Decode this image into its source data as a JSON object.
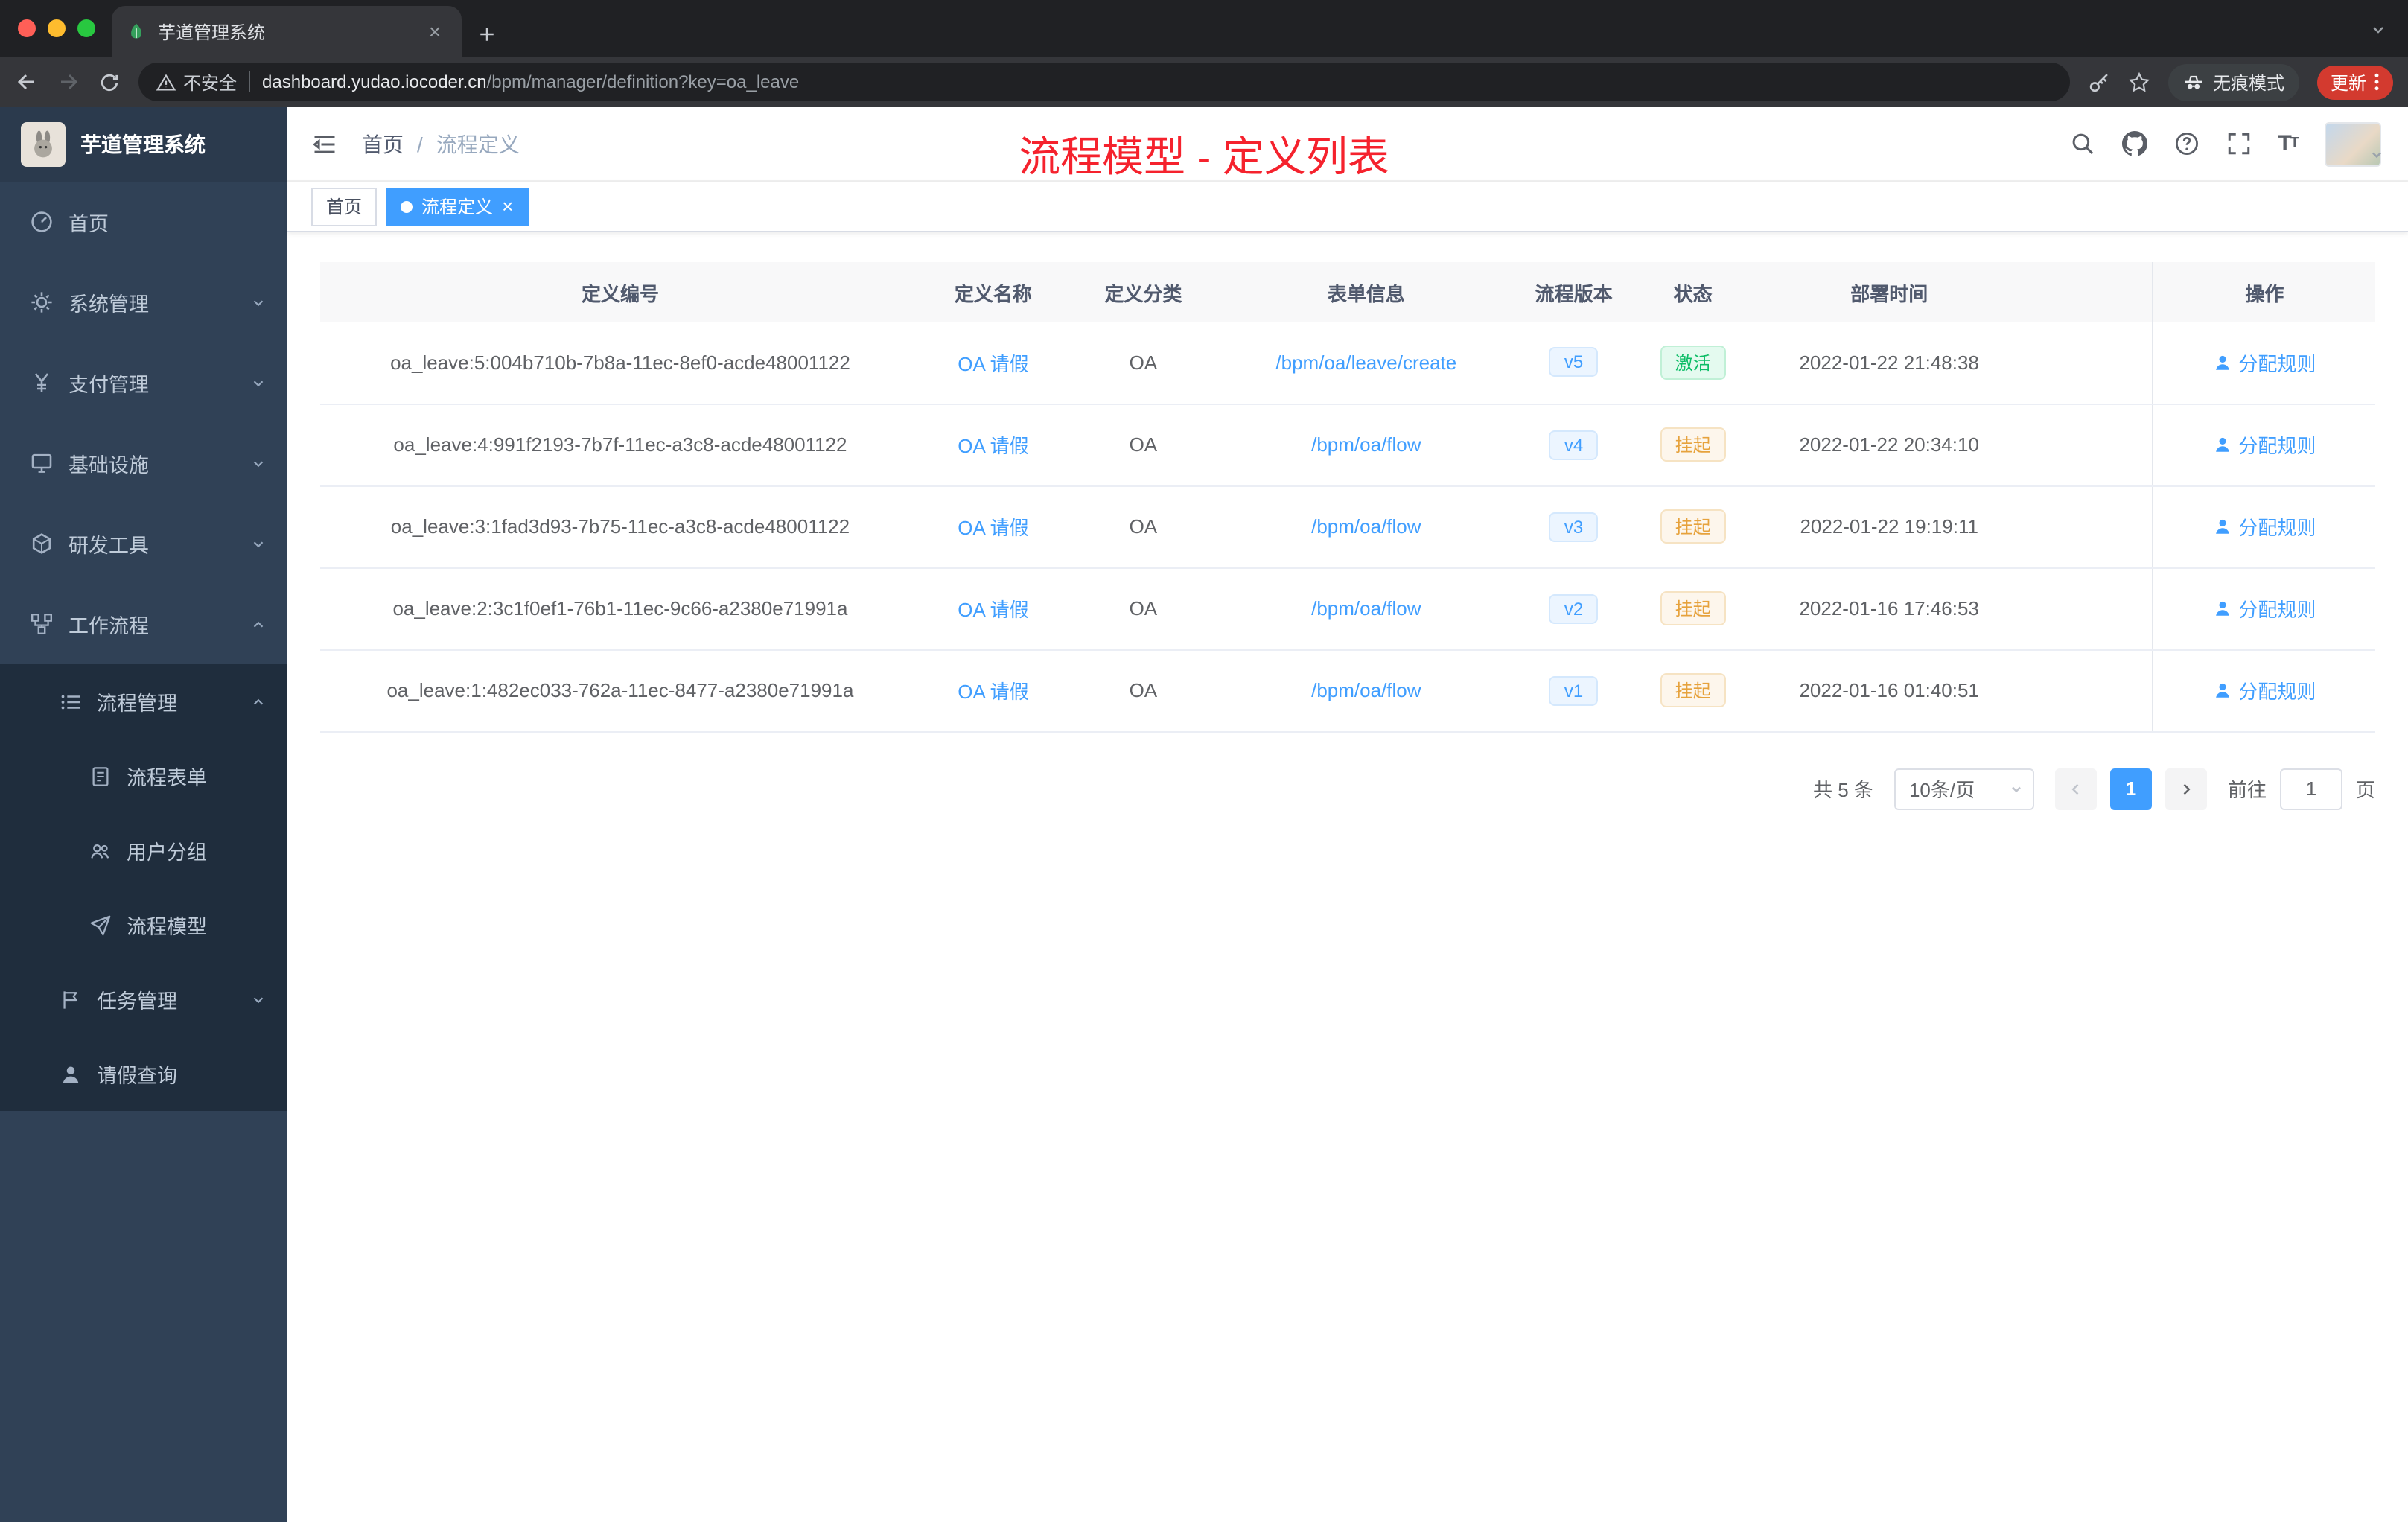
{
  "browser": {
    "tab_title": "芋道管理系统",
    "security_label": "不安全",
    "url_domain": "dashboard.yudao.iocoder.cn",
    "url_path": "/bpm/manager/definition?key=oa_leave",
    "incognito_label": "无痕模式",
    "update_label": "更新"
  },
  "sidebar": {
    "logo_title": "芋道管理系统",
    "items": [
      {
        "label": "首页"
      },
      {
        "label": "系统管理"
      },
      {
        "label": "支付管理"
      },
      {
        "label": "基础设施"
      },
      {
        "label": "研发工具"
      },
      {
        "label": "工作流程"
      }
    ],
    "workflow": {
      "process_mgmt": "流程管理",
      "process_form": "流程表单",
      "user_group": "用户分组",
      "process_model": "流程模型",
      "task_mgmt": "任务管理",
      "leave_query": "请假查询"
    }
  },
  "header": {
    "breadcrumb_home": "首页",
    "breadcrumb_sep": "/",
    "breadcrumb_current": "流程定义",
    "overlay_title": "流程模型 - 定义列表",
    "font_icon_big": "T",
    "font_icon_small": "T"
  },
  "tags": {
    "home": "首页",
    "current": "流程定义",
    "close": "×"
  },
  "table": {
    "columns": [
      "定义编号",
      "定义名称",
      "定义分类",
      "表单信息",
      "流程版本",
      "状态",
      "部署时间",
      "",
      "操作"
    ],
    "rows": [
      {
        "id": "oa_leave:5:004b710b-7b8a-11ec-8ef0-acde48001122",
        "name": "OA 请假",
        "category": "OA",
        "form": "/bpm/oa/leave/create",
        "version": "v5",
        "status": "激活",
        "time": "2022-01-22 21:48:38",
        "action": "分配规则"
      },
      {
        "id": "oa_leave:4:991f2193-7b7f-11ec-a3c8-acde48001122",
        "name": "OA 请假",
        "category": "OA",
        "form": "/bpm/oa/flow",
        "version": "v4",
        "status": "挂起",
        "time": "2022-01-22 20:34:10",
        "action": "分配规则"
      },
      {
        "id": "oa_leave:3:1fad3d93-7b75-11ec-a3c8-acde48001122",
        "name": "OA 请假",
        "category": "OA",
        "form": "/bpm/oa/flow",
        "version": "v3",
        "status": "挂起",
        "time": "2022-01-22 19:19:11",
        "action": "分配规则"
      },
      {
        "id": "oa_leave:2:3c1f0ef1-76b1-11ec-9c66-a2380e71991a",
        "name": "OA 请假",
        "category": "OA",
        "form": "/bpm/oa/flow",
        "version": "v2",
        "status": "挂起",
        "time": "2022-01-16 17:46:53",
        "action": "分配规则"
      },
      {
        "id": "oa_leave:1:482ec033-762a-11ec-8477-a2380e71991a",
        "name": "OA 请假",
        "category": "OA",
        "form": "/bpm/oa/flow",
        "version": "v1",
        "status": "挂起",
        "time": "2022-01-16 01:40:51",
        "action": "分配规则"
      }
    ]
  },
  "pagination": {
    "total_label": "共 5 条",
    "page_size": "10条/页",
    "current_page": "1",
    "goto_label": "前往",
    "goto_value": "1",
    "page_unit": "页"
  }
}
